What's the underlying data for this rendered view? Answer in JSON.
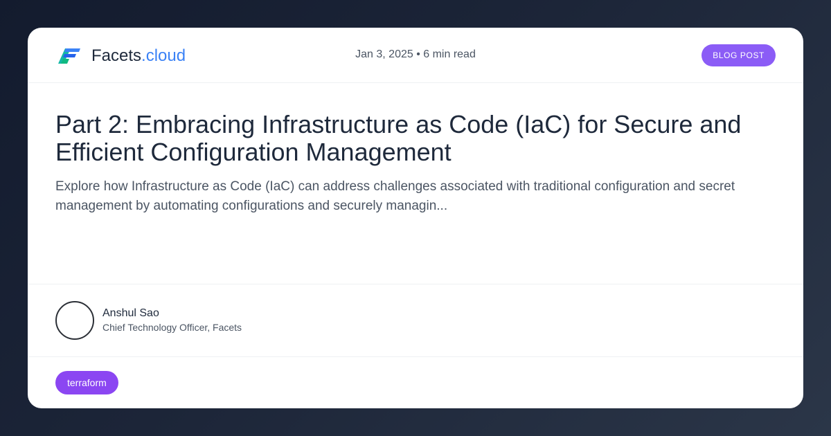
{
  "brand": {
    "name": "Facets",
    "tld": ".cloud",
    "logo_icon": "facets-logo-icon",
    "brand_color": "#3b82f6"
  },
  "post": {
    "meta": "Jan 3, 2025 • 6 min read",
    "badge": "BLOG POST",
    "title": "Part 2: Embracing Infrastructure as Code (IaC) for Secure and Efficient Configuration Management",
    "description": "Explore how Infrastructure as Code (IaC) can address challenges associated with traditional configuration and secret management by automating configurations and securely managin..."
  },
  "author": {
    "name": "Anshul Sao",
    "role": "Chief Technology Officer, Facets"
  },
  "tags": [
    "terraform"
  ],
  "colors": {
    "accent": "#8b5cf6",
    "tag": "#8b46f2",
    "text": "#1e293b",
    "muted": "#4b5563"
  }
}
